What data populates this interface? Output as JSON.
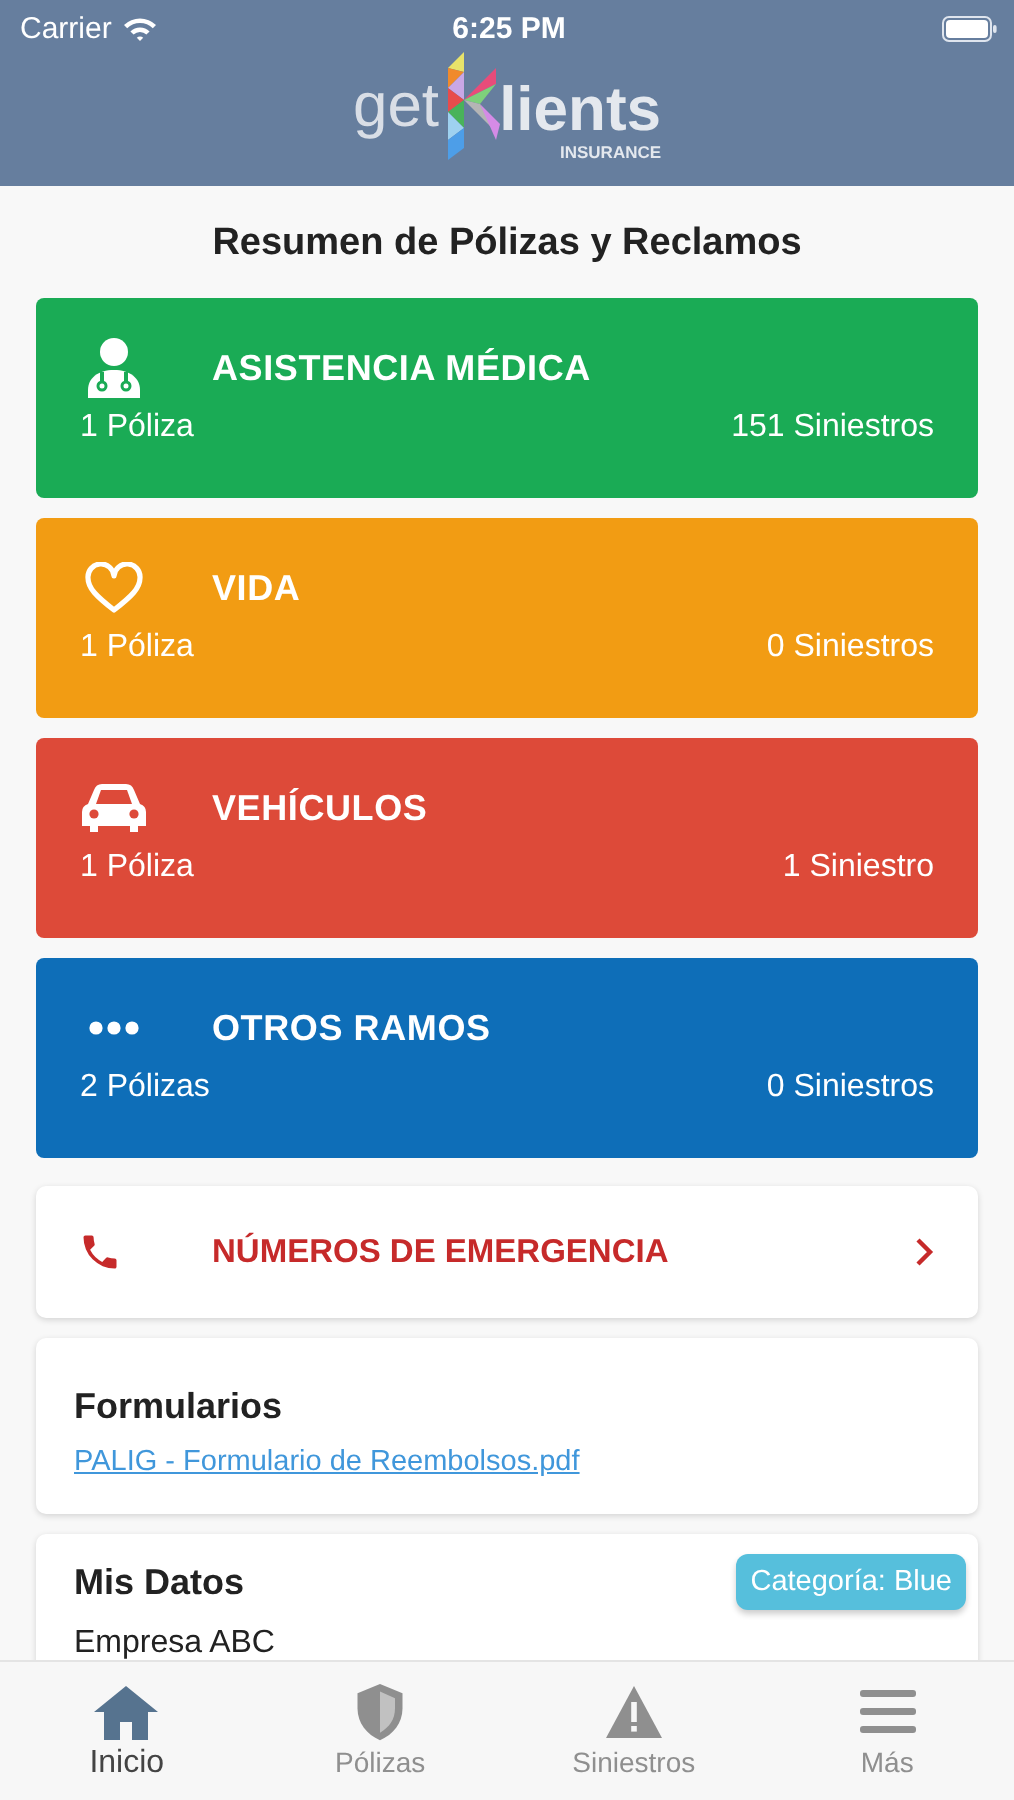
{
  "status_bar": {
    "carrier": "Carrier",
    "time": "6:25 PM"
  },
  "header": {
    "logo_left": "get",
    "logo_right": "lients",
    "logo_sub": "INSURANCE"
  },
  "title": "Resumen de Pólizas y Reclamos",
  "categories": [
    {
      "kind": "doctor",
      "name": "ASISTENCIA MÉDICA",
      "policies": "1 Póliza",
      "claims": "151 Siniestros",
      "color": "#1aab55"
    },
    {
      "kind": "heart",
      "name": "VIDA",
      "policies": "1 Póliza",
      "claims": "0 Siniestros",
      "color": "#f29c13"
    },
    {
      "kind": "car",
      "name": "VEHÍCULOS",
      "policies": "1 Póliza",
      "claims": "1 Siniestro",
      "color": "#dd4a39"
    },
    {
      "kind": "dots",
      "name": "OTROS RAMOS",
      "policies": "2 Pólizas",
      "claims": "0 Siniestros",
      "color": "#0e6eb8"
    }
  ],
  "emergency": {
    "label": "NÚMEROS DE EMERGENCIA"
  },
  "forms": {
    "title": "Formularios",
    "link": "PALIG - Formulario de Reembolsos.pdf"
  },
  "my_data": {
    "title": "Mis Datos",
    "badge": "Categoría: Blue",
    "company": "Empresa ABC"
  },
  "tabs": [
    {
      "kind": "home",
      "label": "Inicio",
      "selected": true
    },
    {
      "kind": "shield",
      "label": "Pólizas",
      "selected": false
    },
    {
      "kind": "warning",
      "label": "Siniestros",
      "selected": false
    },
    {
      "kind": "menu",
      "label": "Más",
      "selected": false
    }
  ]
}
